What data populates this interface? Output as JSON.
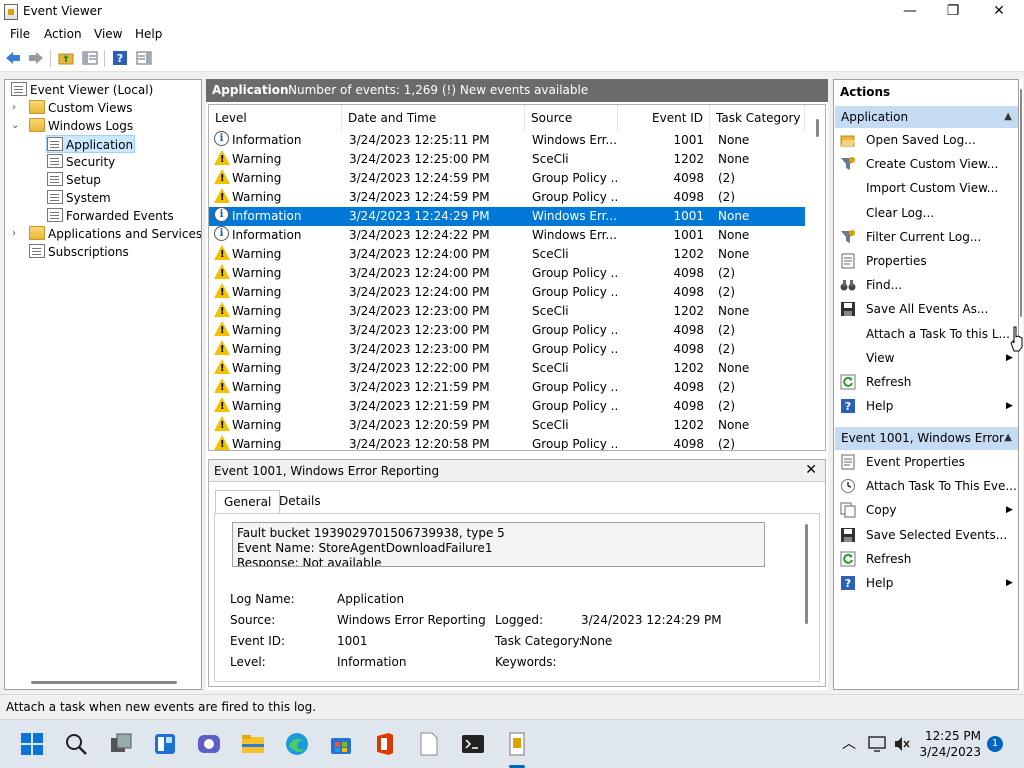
{
  "window": {
    "title": "Event Viewer",
    "minimize": "—",
    "maximize": "❐",
    "close": "✕"
  },
  "menu": [
    "File",
    "Action",
    "View",
    "Help"
  ],
  "tree": [
    {
      "label": "Event Viewer (Local)",
      "level": 0,
      "expanded": true,
      "icon": "event-viewer-icon"
    },
    {
      "label": "Custom Views",
      "level": 1,
      "expander": "collapsed",
      "icon": "folder-icon"
    },
    {
      "label": "Windows Logs",
      "level": 1,
      "expander": "expanded",
      "icon": "folder-icon"
    },
    {
      "label": "Application",
      "level": 2,
      "selected": true,
      "icon": "log-icon"
    },
    {
      "label": "Security",
      "level": 2,
      "icon": "log-icon"
    },
    {
      "label": "Setup",
      "level": 2,
      "icon": "log-icon"
    },
    {
      "label": "System",
      "level": 2,
      "icon": "log-icon"
    },
    {
      "label": "Forwarded Events",
      "level": 2,
      "icon": "log-icon"
    },
    {
      "label": "Applications and Services Lo",
      "level": 1,
      "expander": "collapsed",
      "icon": "folder-icon"
    },
    {
      "label": "Subscriptions",
      "level": 1,
      "icon": "log-icon"
    }
  ],
  "center": {
    "log_name": "Application",
    "event_count": "Number of events: 1,269 (!) New events available",
    "columns": [
      "Level",
      "Date and Time",
      "Source",
      "Event ID",
      "Task Category"
    ],
    "rows": [
      {
        "level": "Information",
        "type": "info",
        "date": "3/24/2023 12:25:11 PM",
        "source": "Windows Err...",
        "id": "1001",
        "cat": "None"
      },
      {
        "level": "Warning",
        "type": "warn",
        "date": "3/24/2023 12:25:00 PM",
        "source": "SceCli",
        "id": "1202",
        "cat": "None"
      },
      {
        "level": "Warning",
        "type": "warn",
        "date": "3/24/2023 12:24:59 PM",
        "source": "Group Policy ...",
        "id": "4098",
        "cat": "(2)"
      },
      {
        "level": "Warning",
        "type": "warn",
        "date": "3/24/2023 12:24:59 PM",
        "source": "Group Policy ...",
        "id": "4098",
        "cat": "(2)"
      },
      {
        "level": "Information",
        "type": "info",
        "date": "3/24/2023 12:24:29 PM",
        "source": "Windows Err...",
        "id": "1001",
        "cat": "None",
        "selected": true
      },
      {
        "level": "Information",
        "type": "info",
        "date": "3/24/2023 12:24:22 PM",
        "source": "Windows Err...",
        "id": "1001",
        "cat": "None"
      },
      {
        "level": "Warning",
        "type": "warn",
        "date": "3/24/2023 12:24:00 PM",
        "source": "SceCli",
        "id": "1202",
        "cat": "None"
      },
      {
        "level": "Warning",
        "type": "warn",
        "date": "3/24/2023 12:24:00 PM",
        "source": "Group Policy ...",
        "id": "4098",
        "cat": "(2)"
      },
      {
        "level": "Warning",
        "type": "warn",
        "date": "3/24/2023 12:24:00 PM",
        "source": "Group Policy ...",
        "id": "4098",
        "cat": "(2)"
      },
      {
        "level": "Warning",
        "type": "warn",
        "date": "3/24/2023 12:23:00 PM",
        "source": "SceCli",
        "id": "1202",
        "cat": "None"
      },
      {
        "level": "Warning",
        "type": "warn",
        "date": "3/24/2023 12:23:00 PM",
        "source": "Group Policy ...",
        "id": "4098",
        "cat": "(2)"
      },
      {
        "level": "Warning",
        "type": "warn",
        "date": "3/24/2023 12:23:00 PM",
        "source": "Group Policy ...",
        "id": "4098",
        "cat": "(2)"
      },
      {
        "level": "Warning",
        "type": "warn",
        "date": "3/24/2023 12:22:00 PM",
        "source": "SceCli",
        "id": "1202",
        "cat": "None"
      },
      {
        "level": "Warning",
        "type": "warn",
        "date": "3/24/2023 12:21:59 PM",
        "source": "Group Policy ...",
        "id": "4098",
        "cat": "(2)"
      },
      {
        "level": "Warning",
        "type": "warn",
        "date": "3/24/2023 12:21:59 PM",
        "source": "Group Policy ...",
        "id": "4098",
        "cat": "(2)"
      },
      {
        "level": "Warning",
        "type": "warn",
        "date": "3/24/2023 12:20:59 PM",
        "source": "SceCli",
        "id": "1202",
        "cat": "None"
      },
      {
        "level": "Warning",
        "type": "warn",
        "date": "3/24/2023 12:20:58 PM",
        "source": "Group Policy ...",
        "id": "4098",
        "cat": "(2)"
      }
    ]
  },
  "detail": {
    "title": "Event 1001, Windows Error Reporting",
    "close": "✕",
    "tabs": [
      "General",
      "Details"
    ],
    "description": [
      "Fault bucket 1939029701506739938, type 5",
      "Event Name: StoreAgentDownloadFailure1",
      "Response: Not available"
    ],
    "fields": {
      "log_name_label": "Log Name:",
      "log_name": "Application",
      "source_label": "Source:",
      "source": "Windows Error Reporting",
      "logged_label": "Logged:",
      "logged": "3/24/2023 12:24:29 PM",
      "event_id_label": "Event ID:",
      "event_id": "1001",
      "task_label": "Task Category:",
      "task": "None",
      "level_label": "Level:",
      "level": "Information",
      "keywords_label": "Keywords:",
      "keywords": ""
    }
  },
  "actions": {
    "title": "Actions",
    "section1": "Application",
    "items1": [
      {
        "label": "Open Saved Log...",
        "icon": "open-folder-icon"
      },
      {
        "label": "Create Custom View...",
        "icon": "filter-icon"
      },
      {
        "label": "Import Custom View...",
        "icon": ""
      },
      {
        "label": "Clear Log...",
        "icon": ""
      },
      {
        "label": "Filter Current Log...",
        "icon": "filter-icon"
      },
      {
        "label": "Properties",
        "icon": "properties-icon"
      },
      {
        "label": "Find...",
        "icon": "binoculars-icon"
      },
      {
        "label": "Save All Events As...",
        "icon": "save-icon"
      },
      {
        "label": "Attach a Task To this L...",
        "icon": ""
      },
      {
        "label": "View",
        "icon": "",
        "submenu": true
      },
      {
        "label": "Refresh",
        "icon": "refresh-icon"
      },
      {
        "label": "Help",
        "icon": "help-icon",
        "submenu": true
      }
    ],
    "section2": "Event 1001, Windows Error ...",
    "items2": [
      {
        "label": "Event Properties",
        "icon": "properties-icon"
      },
      {
        "label": "Attach Task To This Eve...",
        "icon": "task-icon"
      },
      {
        "label": "Copy",
        "icon": "copy-icon",
        "submenu": true
      },
      {
        "label": "Save Selected Events...",
        "icon": "save-icon"
      },
      {
        "label": "Refresh",
        "icon": "refresh-icon"
      },
      {
        "label": "Help",
        "icon": "help-icon",
        "submenu": true
      }
    ]
  },
  "status": "Attach a task when new events are fired to this log.",
  "taskbar": {
    "time": "12:25 PM",
    "date": "3/24/2023",
    "notifications": "1"
  },
  "colors": {
    "selection": "#0078d7",
    "header_gray": "#6b6b6b",
    "actions_header": "#c5daf3",
    "tree_selection": "#cce8ff"
  }
}
